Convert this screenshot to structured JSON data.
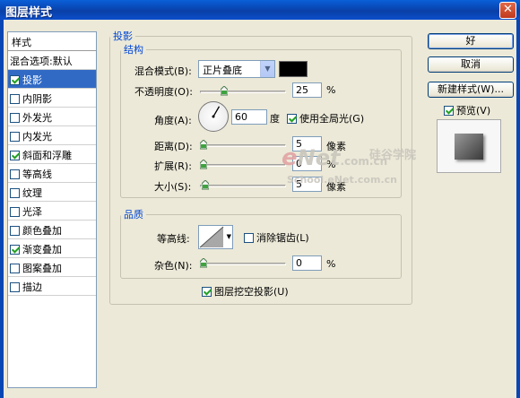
{
  "window": {
    "title": "图层样式",
    "close_glyph": "✕"
  },
  "styles": {
    "header": "样式",
    "blend_options": "混合选项:默认",
    "items": [
      {
        "label": "投影",
        "checked": true,
        "selected": true
      },
      {
        "label": "内阴影",
        "checked": false
      },
      {
        "label": "外发光",
        "checked": false
      },
      {
        "label": "内发光",
        "checked": false
      },
      {
        "label": "斜面和浮雕",
        "checked": true
      },
      {
        "label": "等高线",
        "checked": false,
        "sub": true
      },
      {
        "label": "纹理",
        "checked": false,
        "sub": true
      },
      {
        "label": "光泽",
        "checked": false
      },
      {
        "label": "颜色叠加",
        "checked": false
      },
      {
        "label": "渐变叠加",
        "checked": true
      },
      {
        "label": "图案叠加",
        "checked": false
      },
      {
        "label": "描边",
        "checked": false
      }
    ]
  },
  "drop_shadow": {
    "group_title": "投影",
    "structure": {
      "title": "结构",
      "blend_mode_label": "混合模式(B):",
      "blend_mode_value": "正片叠底",
      "blend_color": "#000000",
      "opacity_label": "不透明度(O):",
      "opacity_value": "25",
      "opacity_unit": "%",
      "angle_label": "角度(A):",
      "angle_value": "60",
      "angle_unit": "度",
      "global_light_label": "使用全局光(G)",
      "global_light_checked": true,
      "distance_label": "距离(D):",
      "distance_value": "5",
      "distance_unit": "像素",
      "spread_label": "扩展(R):",
      "spread_value": "0",
      "spread_unit": "%",
      "size_label": "大小(S):",
      "size_value": "5",
      "size_unit": "像素"
    },
    "quality": {
      "title": "品质",
      "contour_label": "等高线:",
      "antialias_label": "消除锯齿(L)",
      "antialias_checked": false,
      "noise_label": "杂色(N):",
      "noise_value": "0",
      "noise_unit": "%"
    },
    "knockout_label": "图层挖空投影(U)",
    "knockout_checked": true
  },
  "buttons": {
    "ok": "好",
    "cancel": "取消",
    "new_style": "新建样式(W)..."
  },
  "preview": {
    "label": "预览(V)",
    "checked": true
  },
  "watermark": {
    "brand_e": "e",
    "brand_net": "Net",
    "brand_domain": ".com.cn",
    "brand_cn": "硅谷学院",
    "school": "School.eNet.com.cn"
  }
}
